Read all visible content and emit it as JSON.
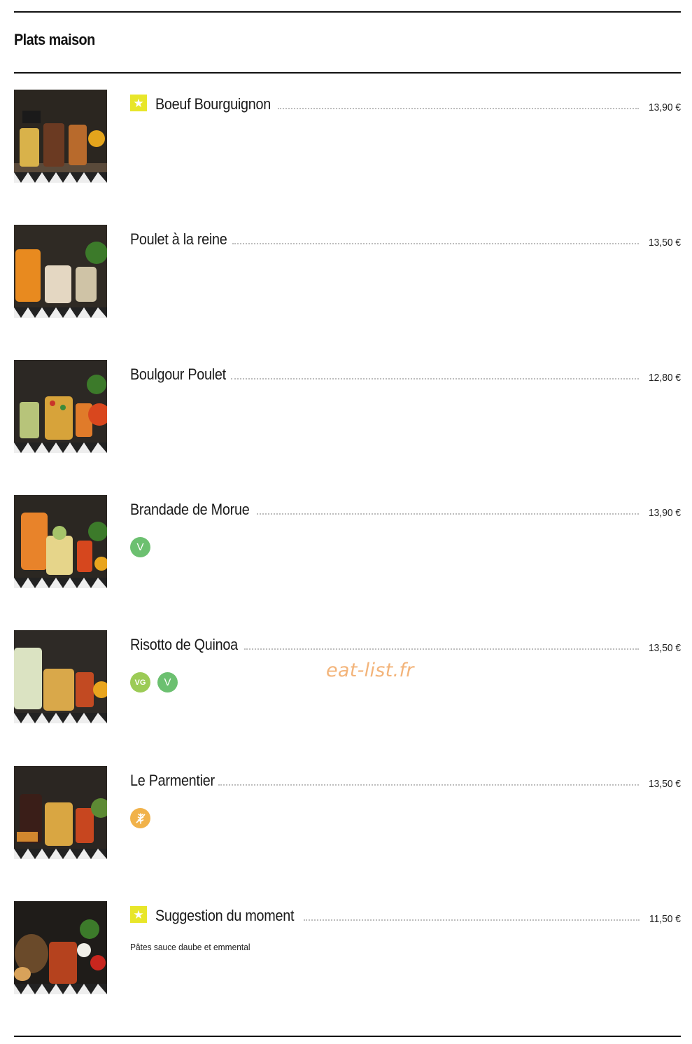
{
  "section": {
    "title": "Plats maison"
  },
  "watermark": "eat-list.fr",
  "colors": {
    "star_badge": "#e8e62a",
    "vegetarian": "#6cc070",
    "vegan": "#9ccb56",
    "gluten_free": "#f1b24a"
  },
  "items": [
    {
      "name": "Boeuf Bourguignon",
      "price": "13,90 €",
      "featured": true,
      "badges": [],
      "image_icon": "dish-jars-photo"
    },
    {
      "name": "Poulet à la reine",
      "price": "13,50 €",
      "featured": false,
      "badges": [],
      "image_icon": "dish-jars-photo"
    },
    {
      "name": "Boulgour Poulet",
      "price": "12,80 €",
      "featured": false,
      "badges": [],
      "image_icon": "dish-jars-photo"
    },
    {
      "name": "Brandade de Morue",
      "price": "13,90 €",
      "featured": false,
      "badges": [
        {
          "label": "V",
          "icon": "vegetarian-icon"
        }
      ],
      "image_icon": "dish-jars-photo"
    },
    {
      "name": "Risotto de Quinoa",
      "price": "13,50 €",
      "featured": false,
      "badges": [
        {
          "label": "VG",
          "icon": "vegan-icon"
        },
        {
          "label": "V",
          "icon": "vegetarian-icon"
        }
      ],
      "image_icon": "dish-jars-photo"
    },
    {
      "name": "Le Parmentier",
      "price": "13,50 €",
      "featured": false,
      "badges": [
        {
          "label": "",
          "icon": "gluten-free-icon"
        }
      ],
      "image_icon": "dish-jars-photo"
    },
    {
      "name": "Suggestion du moment",
      "price": "11,50 €",
      "featured": true,
      "description": "Pâtes sauce daube et emmental",
      "badges": [],
      "image_icon": "dish-jars-photo"
    }
  ]
}
